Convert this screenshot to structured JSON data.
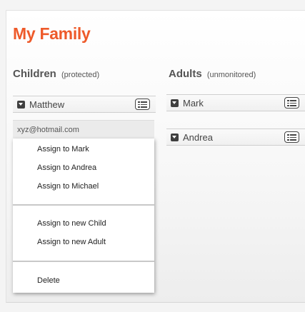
{
  "page": {
    "title": "My Family"
  },
  "children": {
    "heading": "Children",
    "heading_note": "(protected)",
    "members": [
      {
        "name": "Matthew",
        "email": "xyz@hotmail.com"
      }
    ]
  },
  "adults": {
    "heading": "Adults",
    "heading_note": "(unmonitored)",
    "members": [
      {
        "name": "Mark"
      },
      {
        "name": "Andrea"
      }
    ]
  },
  "context_menu": {
    "assign_existing": [
      "Assign to Mark",
      "Assign to Andrea",
      "Assign to Michael"
    ],
    "assign_new": [
      "Assign to new Child",
      "Assign to new Adult"
    ],
    "delete_label": "Delete"
  },
  "colors": {
    "title": "#ee5a2a",
    "icon": "#3f3f3f"
  },
  "icons": {
    "row_toggle": "collapse-toggle-icon",
    "row_action": "contact-card-icon"
  }
}
